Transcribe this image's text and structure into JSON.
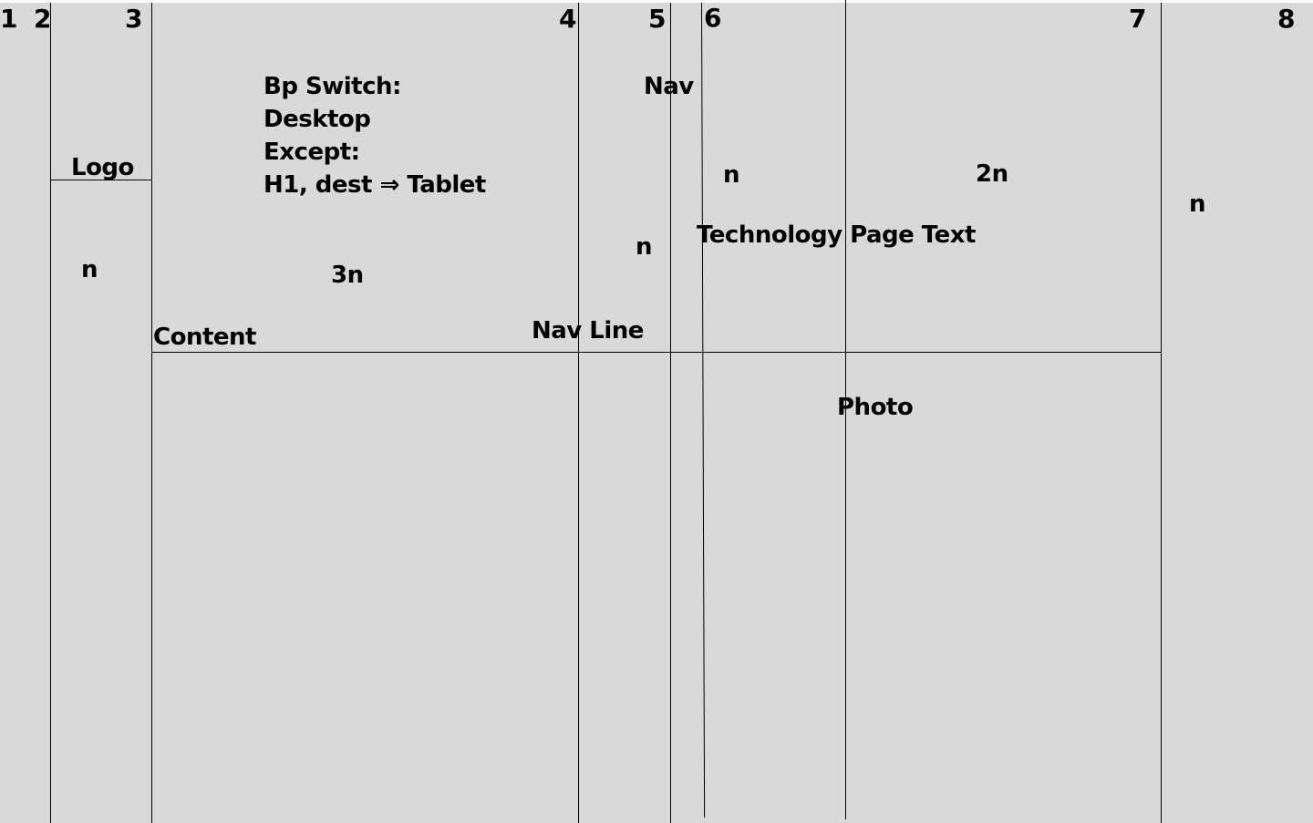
{
  "columns": [
    "1",
    "2",
    "3",
    "4",
    "5",
    "6",
    "7",
    "8"
  ],
  "labels": {
    "logo": "Logo",
    "breakpoint_lines": [
      "Bp Switch:",
      "Desktop",
      "Except:",
      "H1, dest ⇒ Tablet"
    ],
    "nav": "Nav",
    "n_left": "n",
    "n_nav": "n",
    "n_mid": "n",
    "two_n": "2n",
    "n_right": "n",
    "three_n": "3n",
    "content": "Content",
    "nav_line": "Nav Line",
    "technology_page_text": "Technology Page Text",
    "photo": "Photo"
  }
}
